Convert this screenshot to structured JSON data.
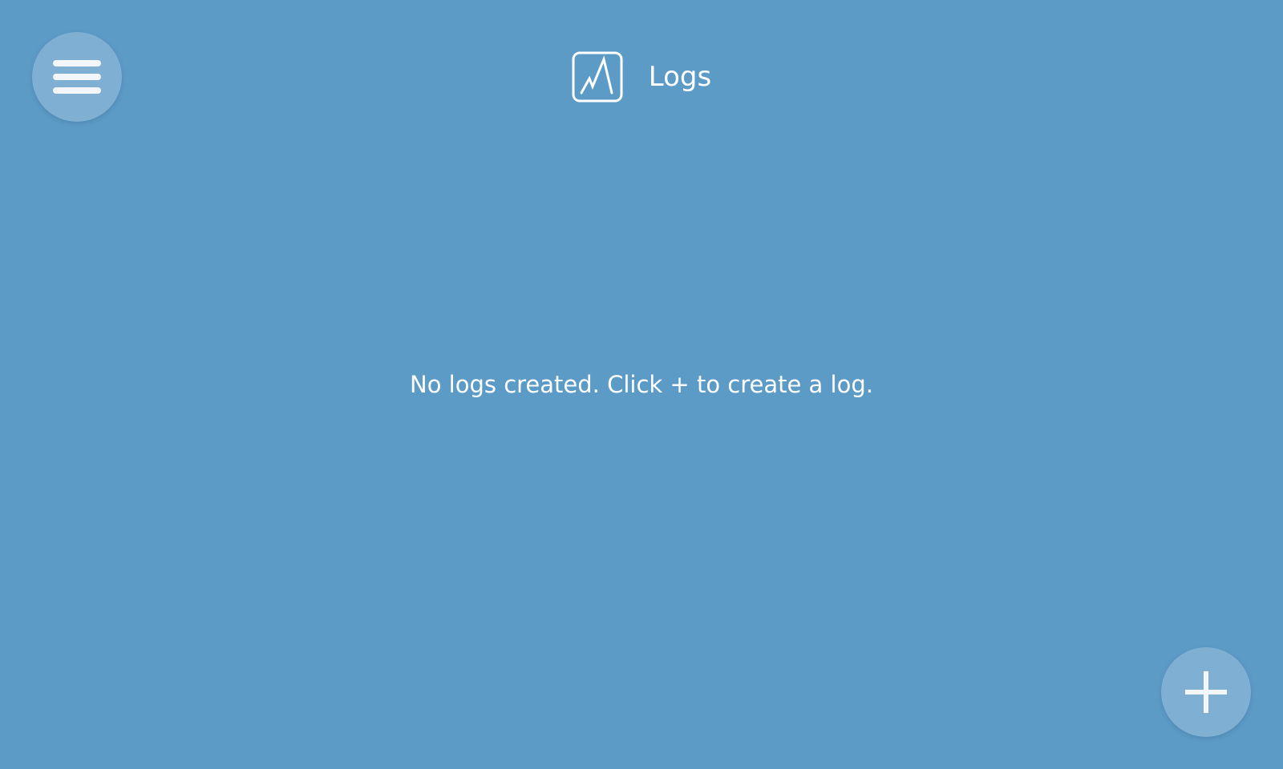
{
  "header": {
    "title": "Logs",
    "icon": "chart-line-icon"
  },
  "menu_button": {
    "icon": "hamburger-menu-icon"
  },
  "empty_state": {
    "message": "No logs created. Click + to create a log."
  },
  "add_button": {
    "icon": "plus-icon"
  },
  "colors": {
    "background": "#5d9bc7",
    "button": "#7fb0d4",
    "text": "#ffffff"
  }
}
